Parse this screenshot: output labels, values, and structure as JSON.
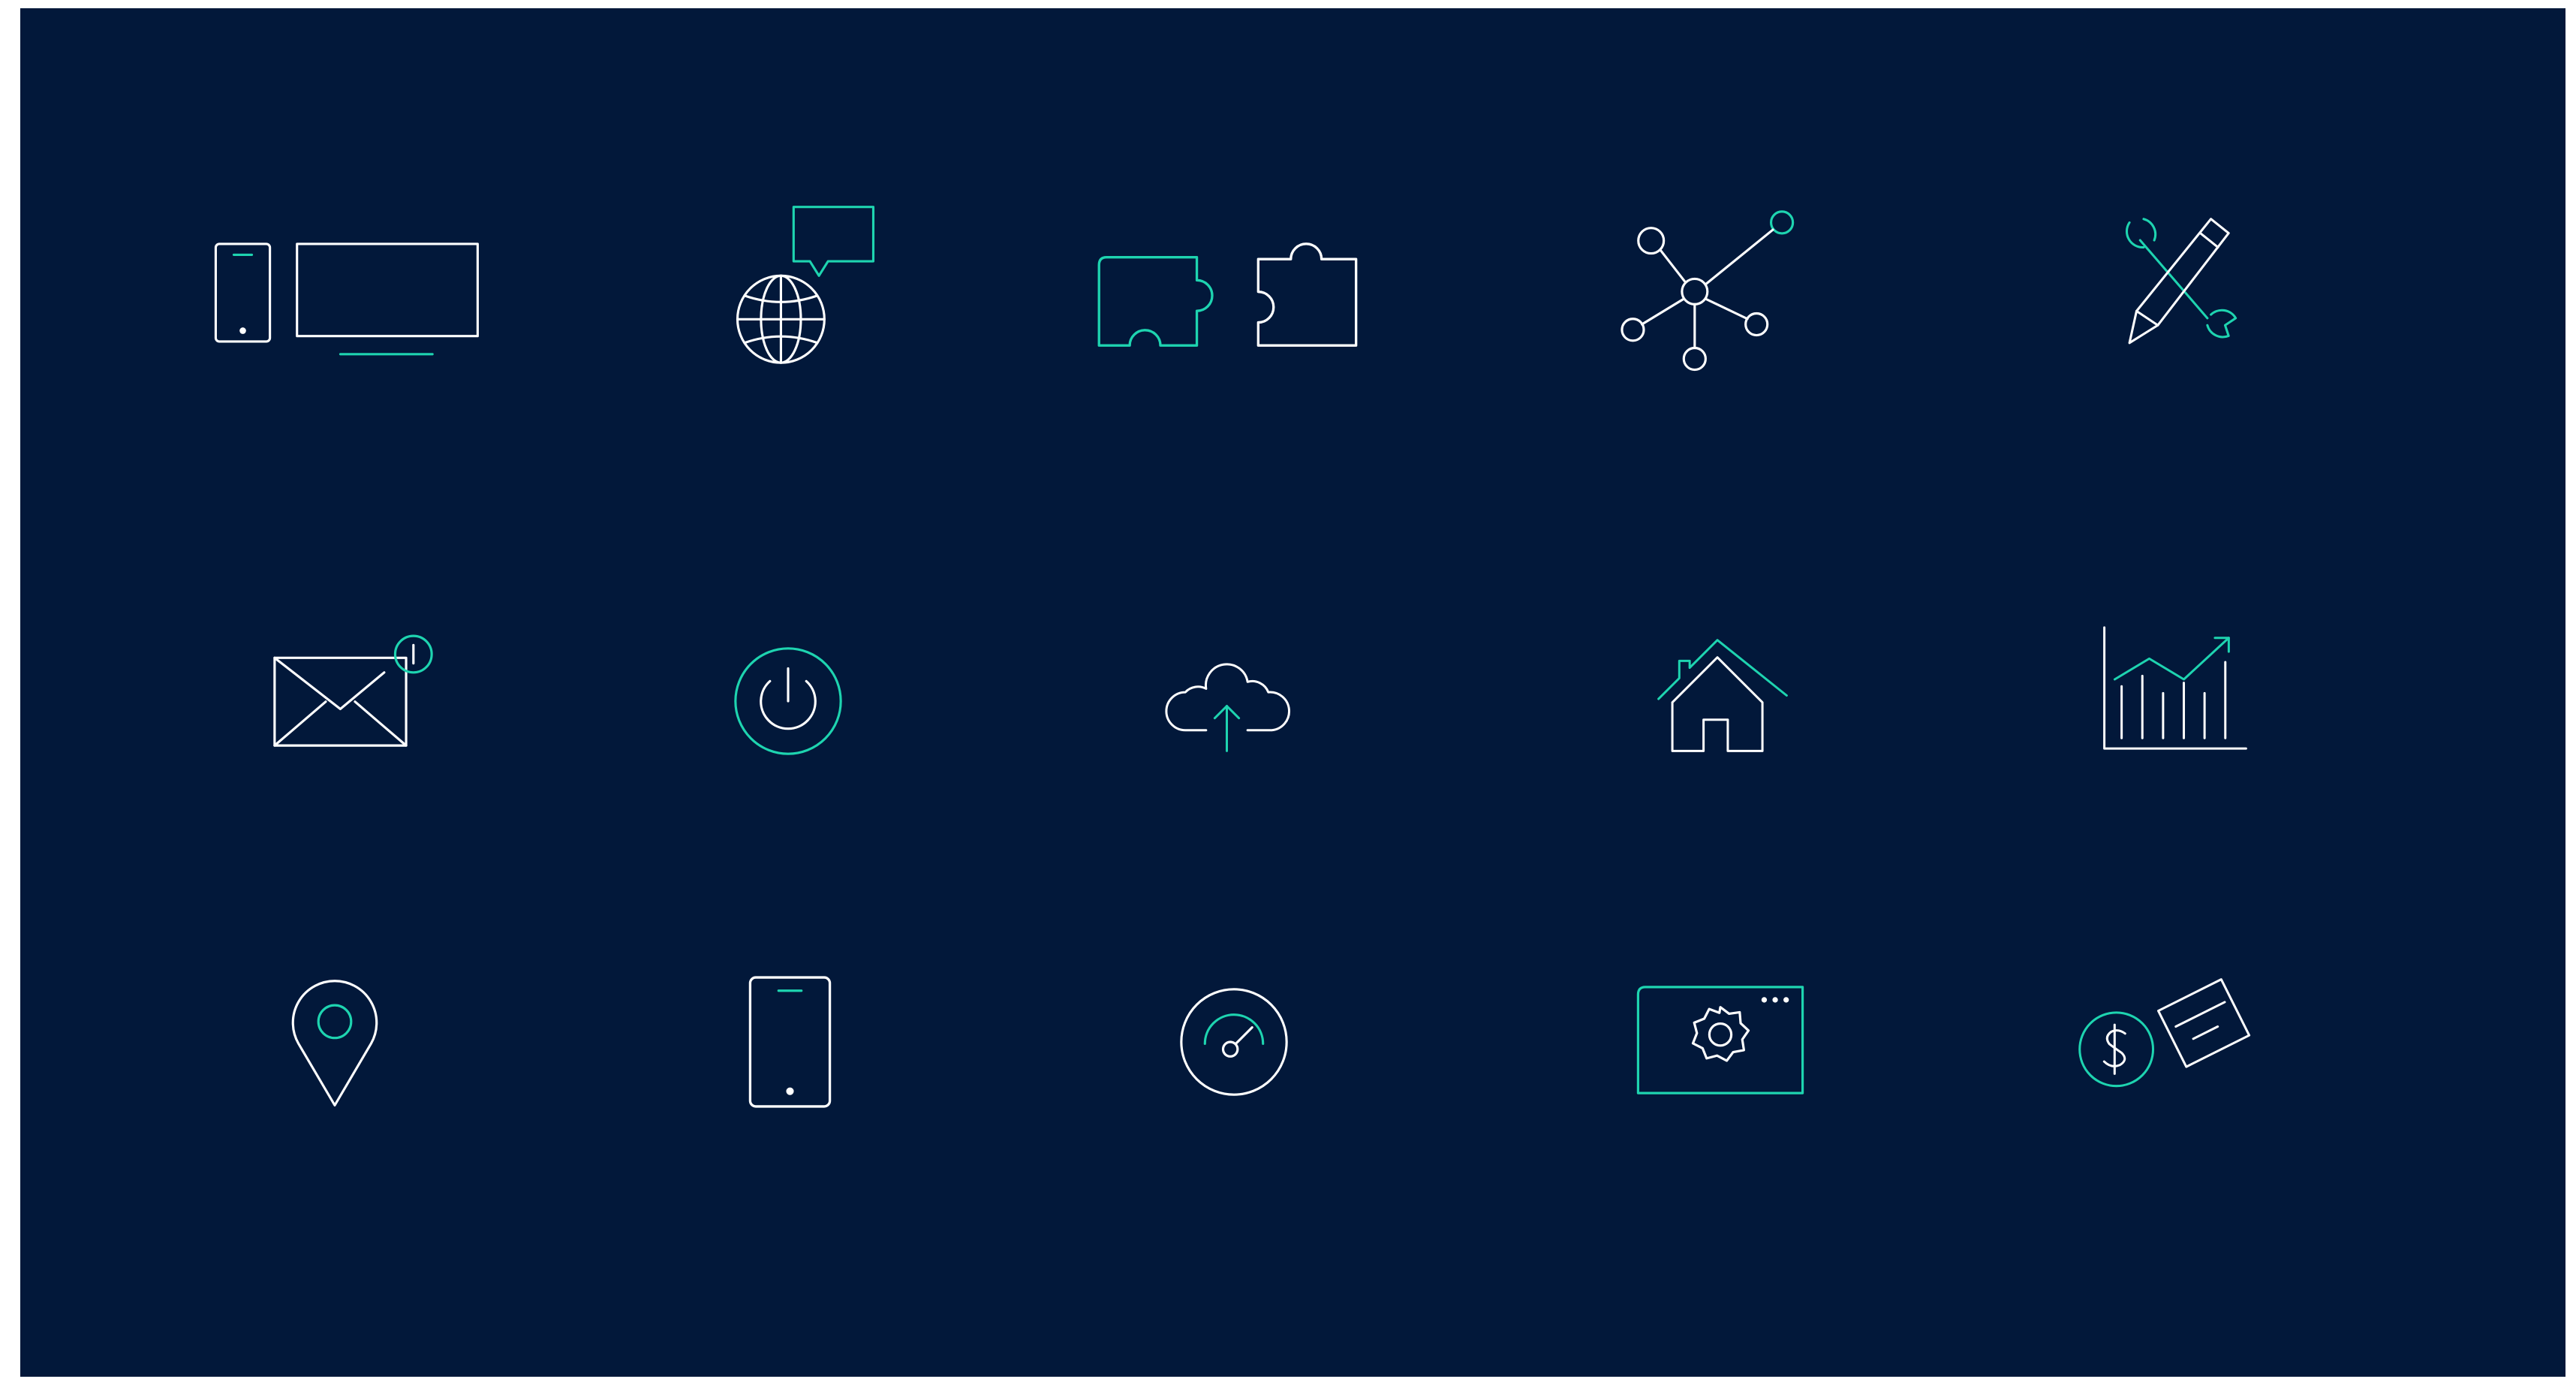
{
  "colors": {
    "background": "#02183a",
    "outline": "#ffffff",
    "accent": "#1ed4b0"
  },
  "icons": [
    {
      "name": "devices-icon"
    },
    {
      "name": "globe-chat-icon"
    },
    {
      "name": "puzzle-pieces-icon"
    },
    {
      "name": "network-nodes-icon"
    },
    {
      "name": "tools-pencil-wrench-icon"
    },
    {
      "name": "mail-notification-icon"
    },
    {
      "name": "power-icon"
    },
    {
      "name": "cloud-upload-icon"
    },
    {
      "name": "home-icon"
    },
    {
      "name": "growth-chart-icon"
    },
    {
      "name": "location-pin-icon"
    },
    {
      "name": "smartphone-icon"
    },
    {
      "name": "speedometer-icon"
    },
    {
      "name": "browser-settings-icon"
    },
    {
      "name": "payment-card-icon"
    }
  ]
}
